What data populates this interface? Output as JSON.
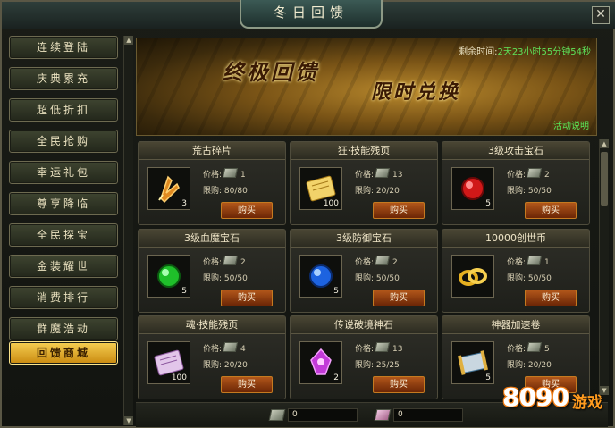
{
  "window": {
    "title": "冬日回馈",
    "close_label": "✕"
  },
  "sidebar": {
    "items": [
      {
        "label": "连续登陆",
        "active": false
      },
      {
        "label": "庆典累充",
        "active": false
      },
      {
        "label": "超低折扣",
        "active": false
      },
      {
        "label": "全民抢购",
        "active": false
      },
      {
        "label": "幸运礼包",
        "active": false
      },
      {
        "label": "尊享降临",
        "active": false
      },
      {
        "label": "全民探宝",
        "active": false
      },
      {
        "label": "金装耀世",
        "active": false
      },
      {
        "label": "消费排行",
        "active": false
      },
      {
        "label": "群魔浩劫",
        "active": false
      },
      {
        "label": "回馈商城",
        "active": true
      }
    ]
  },
  "banner": {
    "title1": "终极回馈",
    "title2": "限时兑换",
    "remaining_label": "剩余时间:",
    "remaining_value": "2天23小时55分钟54秒",
    "rules_link": "活动说明"
  },
  "shop": {
    "price_label": "价格:",
    "limit_label": "限购:",
    "buy_label": "购买",
    "items": [
      {
        "name": "荒古碎片",
        "count": "3",
        "price": "1",
        "limit": "80/80",
        "icon": "ancient-shard-icon",
        "currency": "silver"
      },
      {
        "name": "狂·技能残页",
        "count": "100",
        "price": "13",
        "limit": "20/20",
        "icon": "skill-scroll-gold-icon",
        "currency": "silver"
      },
      {
        "name": "3级攻击宝石",
        "count": "5",
        "price": "2",
        "limit": "50/50",
        "icon": "red-gem-icon",
        "currency": "silver"
      },
      {
        "name": "3级血魔宝石",
        "count": "5",
        "price": "2",
        "limit": "50/50",
        "icon": "green-gem-icon",
        "currency": "silver"
      },
      {
        "name": "3级防御宝石",
        "count": "5",
        "price": "2",
        "limit": "50/50",
        "icon": "blue-gem-icon",
        "currency": "silver"
      },
      {
        "name": "10000创世币",
        "count": "",
        "price": "1",
        "limit": "50/50",
        "icon": "gold-rings-icon",
        "currency": "silver"
      },
      {
        "name": "魂·技能残页",
        "count": "100",
        "price": "4",
        "limit": "20/20",
        "icon": "skill-scroll-purple-icon",
        "currency": "silver"
      },
      {
        "name": "传说破境神石",
        "count": "2",
        "price": "13",
        "limit": "25/25",
        "icon": "purple-stone-icon",
        "currency": "silver"
      },
      {
        "name": "神器加速卷",
        "count": "5",
        "price": "5",
        "limit": "20/20",
        "icon": "artifact-scroll-icon",
        "currency": "silver"
      }
    ]
  },
  "footer": {
    "silver_amount": "0",
    "pink_amount": "0"
  },
  "watermark": {
    "digits": "8090",
    "text": "游戏"
  },
  "colors": {
    "accent_gold": "#f6cf52",
    "buy_button": "#b1561a",
    "time_green": "#5ee35a"
  }
}
